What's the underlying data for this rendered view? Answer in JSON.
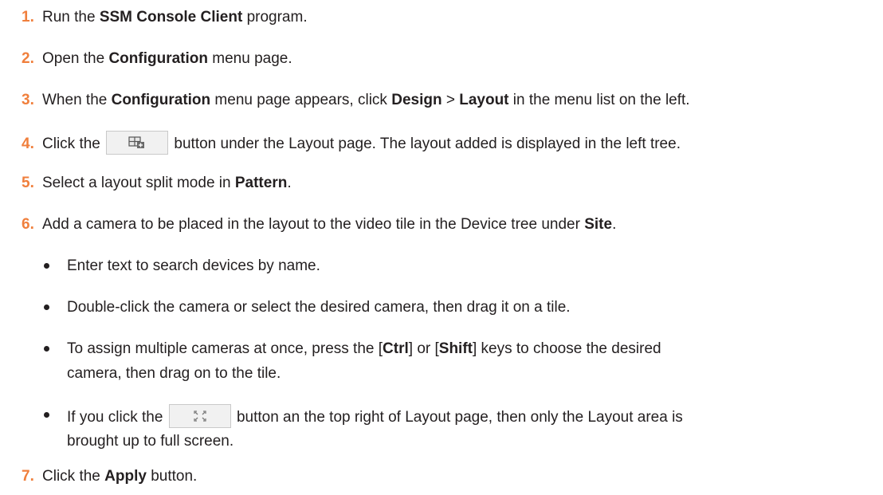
{
  "steps": [
    {
      "num": "1.",
      "pre": "Run the ",
      "bold": "SSM Console Client",
      "post": " program."
    },
    {
      "num": "2.",
      "pre": "Open the ",
      "bold": "Configuration",
      "post": " menu page."
    },
    {
      "num": "3.",
      "pre": "When the ",
      "bold": "Configuration",
      "mid": " menu page appears, click ",
      "bold2": "Design",
      "mid2": " > ",
      "bold3": "Layout",
      "post": " in the menu list on the left."
    },
    {
      "num": "4.",
      "pre": "Click the",
      "post": "button under the Layout page. The layout added is displayed in the left tree.",
      "icon": "add-layout-icon"
    },
    {
      "num": "5.",
      "pre": "Select a layout split mode in ",
      "bold": "Pattern",
      "post": "."
    },
    {
      "num": "6.",
      "pre": "Add a camera to be placed in the layout to the video tile in the Device tree under ",
      "bold": "Site",
      "post": "."
    },
    {
      "num": "7.",
      "pre": "Click the ",
      "bold": "Apply",
      "post": " button."
    }
  ],
  "bullets": [
    {
      "text": "Enter text to search devices by name."
    },
    {
      "text": "Double-click the camera or select the desired camera, then drag it on a tile."
    },
    {
      "pre": "To assign multiple cameras at once, press the [",
      "bold": "Ctrl",
      "mid": "] or [",
      "bold2": "Shift",
      "post": "] keys to choose the desired",
      "line2": "camera, then drag on to the tile."
    },
    {
      "pre": "If you click the",
      "post": "button an the top right of Layout page, then only the Layout area is",
      "line2": "brought up to full screen.",
      "icon": "fullscreen-icon"
    }
  ],
  "colors": {
    "step_number": "#f07f3c",
    "text": "#231f20",
    "button_bg": "#f1f1f1",
    "button_border": "#c9c9c9"
  }
}
